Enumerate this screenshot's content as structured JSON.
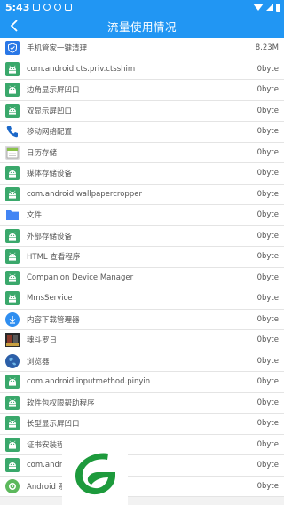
{
  "status_bar": {
    "time": "5:43"
  },
  "app_bar": {
    "title": "流量使用情况"
  },
  "rows": [
    {
      "icon": "shield-icon",
      "name": "手机管家一键清理",
      "value": "8.23M"
    },
    {
      "icon": "android-icon",
      "name": "com.android.cts.priv.ctsshim",
      "value": "0byte"
    },
    {
      "icon": "android-icon",
      "name": "边角显示屏凹口",
      "value": "0byte"
    },
    {
      "icon": "android-icon",
      "name": "双显示屏凹口",
      "value": "0byte"
    },
    {
      "icon": "phone-icon",
      "name": "移动网络配置",
      "value": "0byte"
    },
    {
      "icon": "calendar-icon",
      "name": "日历存储",
      "value": "0byte"
    },
    {
      "icon": "android-icon",
      "name": "媒体存储设备",
      "value": "0byte"
    },
    {
      "icon": "android-icon",
      "name": "com.android.wallpapercropper",
      "value": "0byte"
    },
    {
      "icon": "folder-icon",
      "name": "文件",
      "value": "0byte"
    },
    {
      "icon": "android-icon",
      "name": "外部存储设备",
      "value": "0byte"
    },
    {
      "icon": "android-icon",
      "name": "HTML 查看程序",
      "value": "0byte"
    },
    {
      "icon": "android-icon",
      "name": "Companion Device Manager",
      "value": "0byte"
    },
    {
      "icon": "android-icon",
      "name": "MmsService",
      "value": "0byte"
    },
    {
      "icon": "download-icon",
      "name": "内容下载管理器",
      "value": "0byte"
    },
    {
      "icon": "game-icon",
      "name": "魂斗罗日",
      "value": "0byte"
    },
    {
      "icon": "browser-icon",
      "name": "浏览器",
      "value": "0byte"
    },
    {
      "icon": "android-icon",
      "name": "com.android.inputmethod.pinyin",
      "value": "0byte"
    },
    {
      "icon": "android-icon",
      "name": "软件包权限帮助程序",
      "value": "0byte"
    },
    {
      "icon": "android-icon",
      "name": "长型显示屏凹口",
      "value": "0byte"
    },
    {
      "icon": "android-icon",
      "name": "证书安装程",
      "value": "0byte"
    },
    {
      "icon": "android-icon",
      "name": "com.andro",
      "value": "0byte"
    },
    {
      "icon": "settings-icon",
      "name": "Android 系",
      "value": "0byte"
    }
  ],
  "colors": {
    "primary": "#2196f3",
    "android_green": "#3aa86b",
    "logo_green": "#1d9a3c"
  }
}
